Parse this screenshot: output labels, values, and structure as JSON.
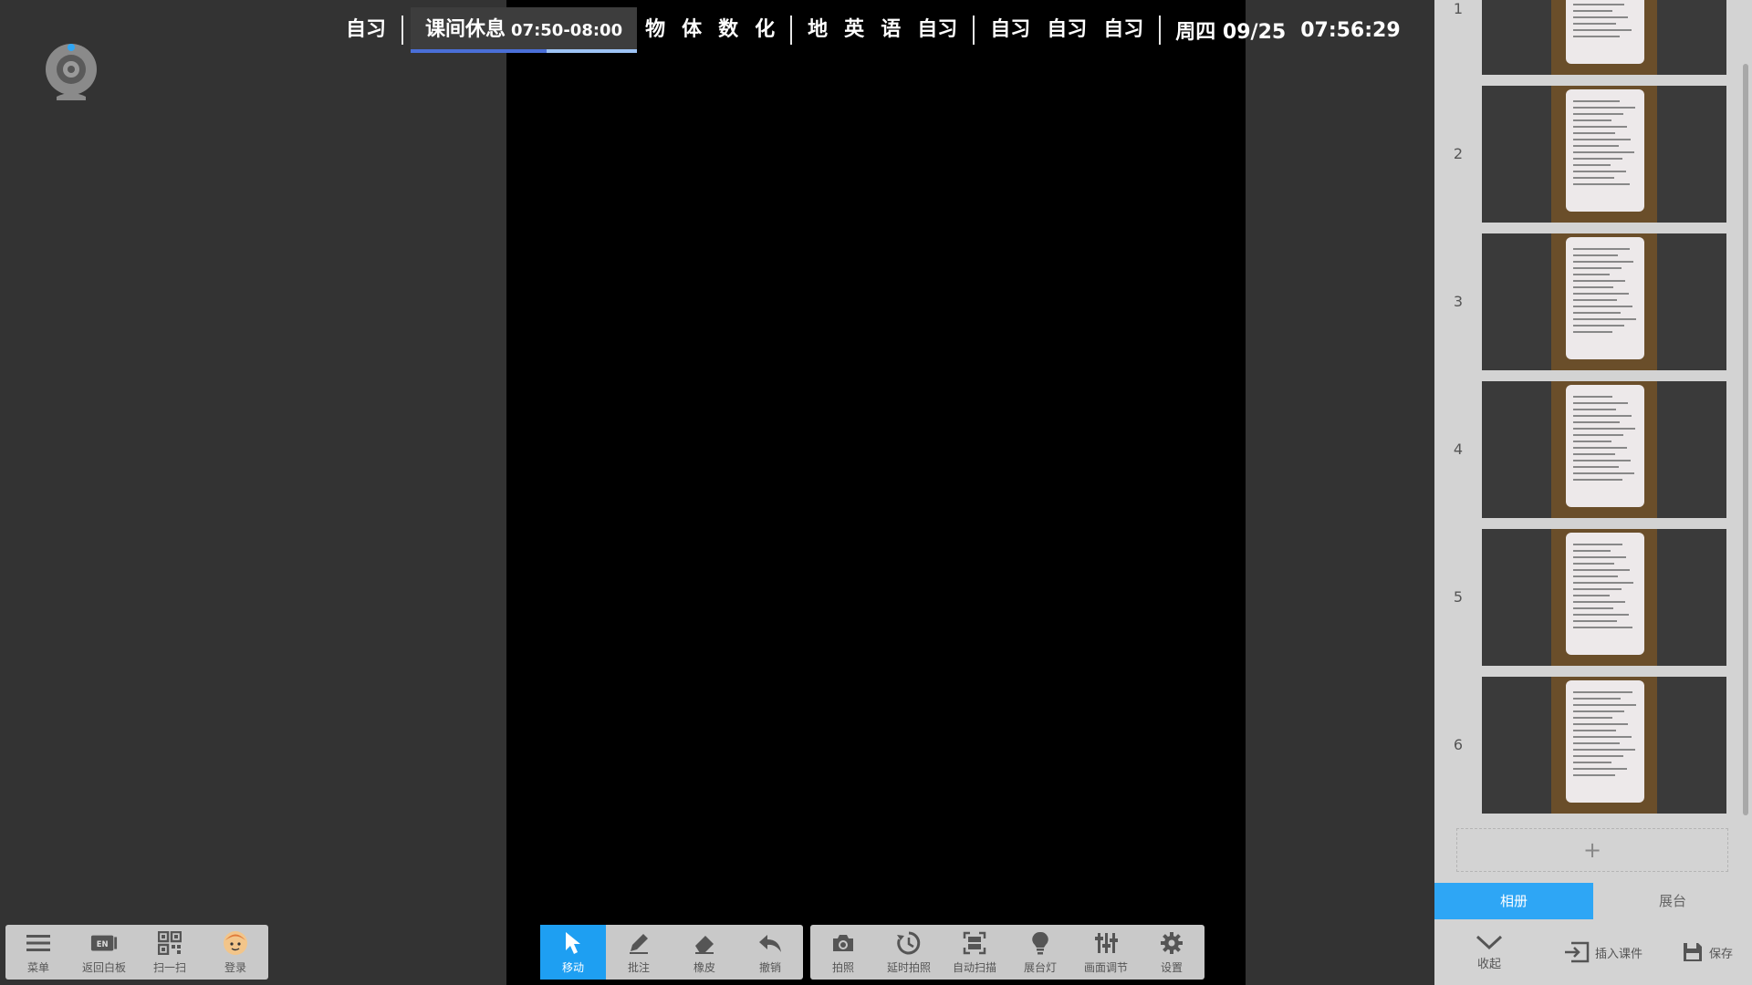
{
  "schedule": {
    "items_left": [
      "自习"
    ],
    "current": {
      "label": "课间休息",
      "time": "07:50-08:00",
      "progress": 0.6
    },
    "items_mid": [
      "物",
      "体",
      "数",
      "化"
    ],
    "items_mid2": [
      "地",
      "英",
      "语",
      "自习"
    ],
    "items_right": [
      "自习",
      "自习",
      "自习"
    ],
    "weekday_date": "周四 09/25",
    "clock": "07:56:29"
  },
  "left_toolbar": {
    "menu": "菜单",
    "whiteboard": "返回白板",
    "scan": "扫一扫",
    "login": "登录"
  },
  "mid_toolbar": {
    "move": "移动",
    "annotate": "批注",
    "eraser": "橡皮",
    "undo": "撤销"
  },
  "right_toolbar": {
    "photo": "拍照",
    "timer_photo": "延时拍照",
    "auto_scan": "自动扫描",
    "lamp": "展台灯",
    "adjust": "画面调节",
    "settings": "设置"
  },
  "side_panel": {
    "thumbnails": [
      "1",
      "2",
      "3",
      "4",
      "5",
      "6"
    ],
    "add_label": "+",
    "tabs": {
      "album": "相册",
      "booth": "展台"
    },
    "collapse": "收起",
    "insert": "插入课件",
    "save": "保存"
  },
  "colors": {
    "accent": "#1e9ff2",
    "tab_active": "#2ea6f5",
    "progress": "#4a6fd8"
  }
}
